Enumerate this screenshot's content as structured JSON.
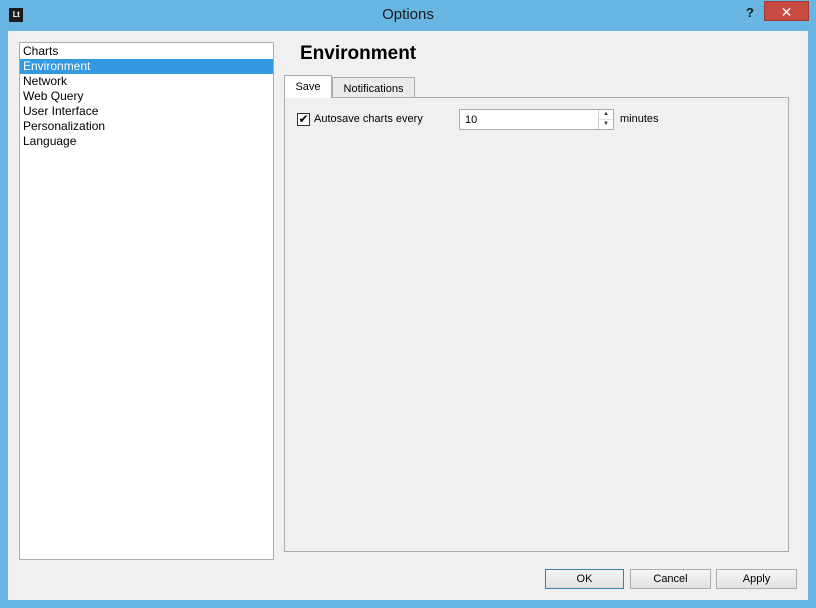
{
  "window": {
    "title": "Options",
    "app_icon_text": "Lt",
    "help_label": "?",
    "close_label": "✕"
  },
  "nav": {
    "items": [
      {
        "label": "Charts",
        "selected": false
      },
      {
        "label": "Environment",
        "selected": true
      },
      {
        "label": "Network",
        "selected": false
      },
      {
        "label": "Web Query",
        "selected": false
      },
      {
        "label": "User Interface",
        "selected": false
      },
      {
        "label": "Personalization",
        "selected": false
      },
      {
        "label": "Language",
        "selected": false
      }
    ]
  },
  "section": {
    "title": "Environment"
  },
  "tabs": [
    {
      "label": "Save",
      "active": true
    },
    {
      "label": "Notifications",
      "active": false
    }
  ],
  "save_tab": {
    "autosave_checked": true,
    "check_glyph": "✔",
    "autosave_label": "Autosave charts every",
    "interval_value": "10",
    "unit_label": "minutes"
  },
  "buttons": {
    "ok": "OK",
    "cancel": "Cancel",
    "apply": "Apply"
  },
  "colors": {
    "title_bar": "#69b6e3",
    "close_button": "#c74b40",
    "selection": "#3399e0"
  }
}
